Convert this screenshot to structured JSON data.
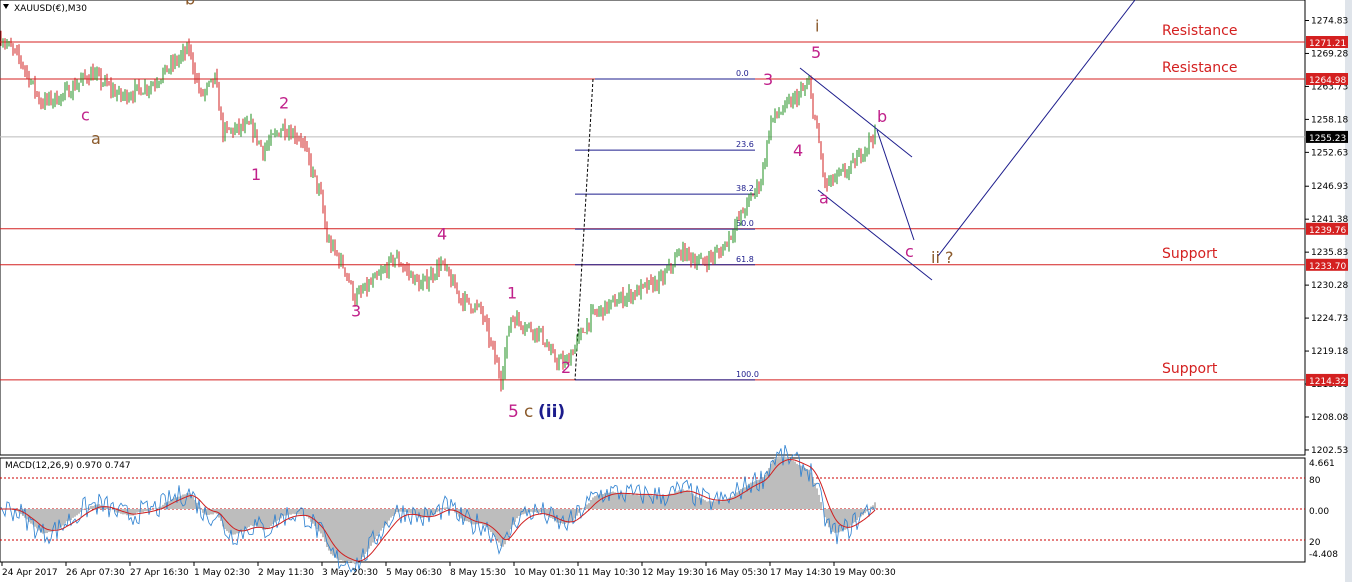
{
  "window": {
    "symbol_title": "XAUUSD(€),M30"
  },
  "colors": {
    "wave": "#c0208a",
    "wave_minor": "#8b5a2b",
    "navy": "#1c1c8c",
    "level": "#d42020",
    "up": "#1f8f1f",
    "down": "#d02020",
    "macd_line": "#2a7fd0",
    "signal": "#d02020",
    "hist": "#bdbdbd"
  },
  "chart_data": {
    "type": "candlestick",
    "title": "XAUUSD(€),M30",
    "ylim": [
      1202.53,
      1274.83
    ],
    "y_ticks": [
      "1274.83",
      "1269.28",
      "1263.73",
      "1258.18",
      "1252.63",
      "1246.93",
      "1241.38",
      "1235.83",
      "1230.28",
      "1224.73",
      "1219.18",
      "1213.63",
      "1208.08",
      "1202.53"
    ],
    "x_ticks": [
      "24 Apr 2017",
      "26 Apr 07:30",
      "27 Apr 16:30",
      "1 May 02:30",
      "2 May 11:30",
      "3 May 20:30",
      "5 May 06:30",
      "8 May 15:30",
      "10 May 01:30",
      "11 May 10:30",
      "12 May 19:30",
      "16 May 05:30",
      "17 May 14:30",
      "19 May 00:30"
    ],
    "current_price": "1255.23",
    "price_path": [
      [
        0,
        1272
      ],
      [
        10,
        1268
      ],
      [
        20,
        1261
      ],
      [
        30,
        1262
      ],
      [
        45,
        1266
      ],
      [
        60,
        1262
      ],
      [
        75,
        1264
      ],
      [
        94,
        1270
      ],
      [
        100,
        1262
      ],
      [
        107,
        1265
      ],
      [
        111,
        1256
      ],
      [
        125,
        1257
      ],
      [
        131,
        1253
      ],
      [
        141,
        1257
      ],
      [
        150,
        1255
      ],
      [
        160,
        1245
      ],
      [
        163,
        1238
      ],
      [
        172,
        1233
      ],
      [
        177,
        1228
      ],
      [
        190,
        1232
      ],
      [
        197,
        1235
      ],
      [
        210,
        1230
      ],
      [
        220,
        1234
      ],
      [
        230,
        1228
      ],
      [
        240,
        1226
      ],
      [
        250,
        1214.5
      ],
      [
        255,
        1225
      ],
      [
        270,
        1222
      ],
      [
        276,
        1218
      ],
      [
        282,
        1217
      ],
      [
        295,
        1225
      ],
      [
        310,
        1228
      ],
      [
        330,
        1231
      ],
      [
        340,
        1236
      ],
      [
        350,
        1234
      ],
      [
        360,
        1236
      ],
      [
        370,
        1242
      ],
      [
        380,
        1248
      ],
      [
        385,
        1258
      ],
      [
        395,
        1261
      ],
      [
        404,
        1264
      ],
      [
        409,
        1254
      ],
      [
        412,
        1247
      ],
      [
        425,
        1250
      ],
      [
        437,
        1256
      ]
    ],
    "levels": [
      {
        "price": 1271.21,
        "label": "1271.21",
        "text": "Resistance"
      },
      {
        "price": 1264.98,
        "label": "1264.98",
        "text": "Resistance"
      },
      {
        "price": 1239.76,
        "label": "1239.76",
        "text": ""
      },
      {
        "price": 1233.7,
        "label": "1233.70",
        "text": "Support"
      },
      {
        "price": 1214.32,
        "label": "1214.32",
        "text": "Support"
      }
    ],
    "fibonacci": [
      {
        "level": "0.0",
        "price": 1264.98
      },
      {
        "level": "23.6",
        "price": 1253.0
      },
      {
        "level": "38.2",
        "price": 1245.6
      },
      {
        "level": "50.0",
        "price": 1239.7
      },
      {
        "level": "61.8",
        "price": 1233.7
      },
      {
        "level": "100.0",
        "price": 1214.32
      }
    ],
    "wave_labels": [
      {
        "text": "b",
        "bar": 94,
        "price": 1277.5,
        "kind": "minor"
      },
      {
        "text": "c",
        "bar": 42,
        "price": 1258,
        "kind": "wave"
      },
      {
        "text": "a",
        "bar": 47,
        "price": 1254,
        "kind": "minor"
      },
      {
        "text": "1",
        "bar": 127,
        "price": 1248,
        "kind": "wave"
      },
      {
        "text": "2",
        "bar": 141,
        "price": 1260,
        "kind": "wave"
      },
      {
        "text": "3",
        "bar": 177,
        "price": 1225,
        "kind": "wave"
      },
      {
        "text": "4",
        "bar": 220,
        "price": 1238,
        "kind": "wave"
      },
      {
        "text": "1",
        "bar": 255,
        "price": 1228,
        "kind": "wave"
      },
      {
        "text": "2",
        "bar": 282,
        "price": 1215.5,
        "kind": "wave"
      },
      {
        "text": "3",
        "bar": 383,
        "price": 1264,
        "kind": "wave"
      },
      {
        "text": "4",
        "bar": 398,
        "price": 1252,
        "kind": "wave"
      },
      {
        "text": "5",
        "bar": 407,
        "price": 1268.5,
        "kind": "wave"
      },
      {
        "text": "i",
        "bar": 409,
        "price": 1273,
        "kind": "minor"
      },
      {
        "text": "a",
        "bar": 411,
        "price": 1244,
        "kind": "wave"
      },
      {
        "text": "b",
        "bar": 440,
        "price": 1257.7,
        "kind": "wave"
      },
      {
        "text": "c",
        "bar": 454,
        "price": 1235,
        "kind": "wave"
      },
      {
        "text": "ii ?",
        "bar": 467,
        "price": 1234,
        "kind": "minor"
      }
    ],
    "wave_label_bottom": {
      "five": "5",
      "c": "c",
      "ii": "(ii)"
    },
    "macd": {
      "label": "MACD(12,26,9) 0.970 0.747",
      "ticks": [
        "4.661",
        "80",
        "0.00",
        "20",
        "-4.408"
      ]
    }
  }
}
